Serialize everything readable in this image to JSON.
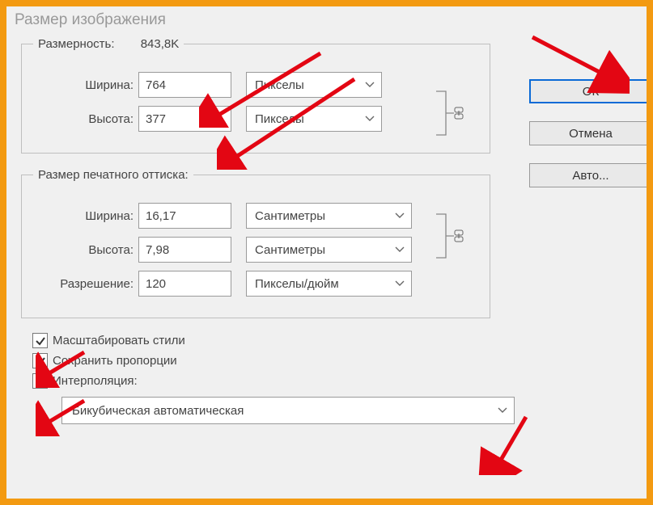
{
  "title": "Размер изображения",
  "pixel_dimensions": {
    "legend_label": "Размерность:",
    "legend_value": "843,8K",
    "width_label": "Ширина:",
    "width_value": "764",
    "width_unit": "Пикселы",
    "height_label": "Высота:",
    "height_value": "377",
    "height_unit": "Пикселы"
  },
  "document_size": {
    "legend_label": "Размер печатного оттиска:",
    "width_label": "Ширина:",
    "width_value": "16,17",
    "width_unit": "Сантиметры",
    "height_label": "Высота:",
    "height_value": "7,98",
    "height_unit": "Сантиметры",
    "resolution_label": "Разрешение:",
    "resolution_value": "120",
    "resolution_unit": "Пикселы/дюйм"
  },
  "checkboxes": {
    "scale_styles": "Масштабировать стили",
    "constrain_proportions": "Сохранить пропорции",
    "resample": "Интерполяция:"
  },
  "interpolation_method": "Бикубическая автоматическая",
  "buttons": {
    "ok": "ОК",
    "cancel": "Отмена",
    "auto": "Авто..."
  },
  "colors": {
    "frame_border": "#f39a11",
    "arrow": "#e30613",
    "primary_button_border": "#0a6ad6"
  }
}
